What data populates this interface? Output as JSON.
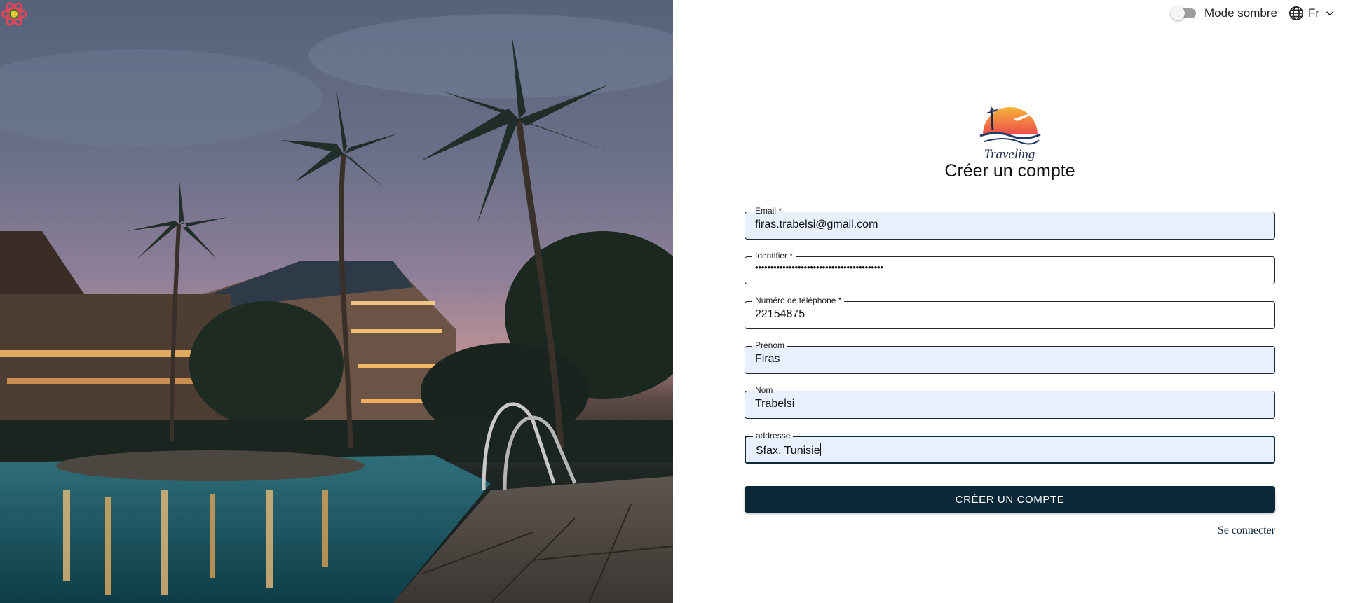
{
  "topbar": {
    "dark_mode_label": "Mode sombre",
    "dark_mode_on": false,
    "language": "Fr"
  },
  "logo": {
    "text": "Traveling"
  },
  "form": {
    "title": "Créer un compte",
    "fields": {
      "email": {
        "label": "Email *",
        "value": "firas.trabelsi@gmail.com"
      },
      "identifier": {
        "label": "Identifier *",
        "value": "••••••••••••••••••••••••••••••••••••••••••"
      },
      "phone": {
        "label": "Numéro de téléphone *",
        "value": "22154875"
      },
      "first_name": {
        "label": "Prénom",
        "value": "Firas"
      },
      "last_name": {
        "label": "Nom",
        "value": "Trabelsi"
      },
      "address": {
        "label": "addresse",
        "value": "Sfax, Tunisie"
      }
    },
    "submit_label": "CRÉER UN COMPTE",
    "login_link": "Se connecter"
  },
  "colors": {
    "primary": "#0b2838",
    "field_fill": "#e8f0fe",
    "logo_sun": "#f28a3c"
  },
  "icons": {
    "toggle": "toggle-switch-icon",
    "language": "globe-icon",
    "dropdown": "chevron-down-icon",
    "devtools": "react-icon"
  }
}
